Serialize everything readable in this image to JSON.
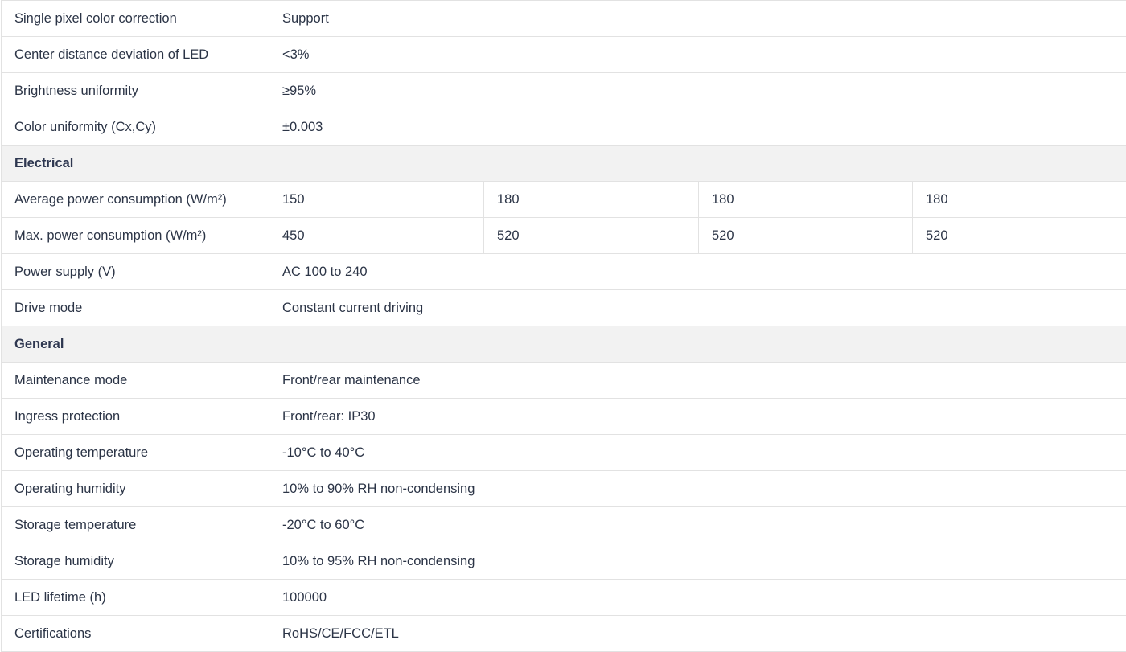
{
  "rows": [
    {
      "type": "spec",
      "label": "Single pixel color correction",
      "values": [
        "Support"
      ]
    },
    {
      "type": "spec",
      "label": "Center distance deviation of LED",
      "values": [
        "<3%"
      ]
    },
    {
      "type": "spec",
      "label": "Brightness uniformity",
      "values": [
        "≥95%"
      ]
    },
    {
      "type": "spec",
      "label": "Color uniformity (Cx,Cy)",
      "values": [
        "±0.003"
      ]
    },
    {
      "type": "section",
      "label": "Electrical"
    },
    {
      "type": "spec",
      "label": "Average power consumption (W/m²)",
      "values": [
        "150",
        "180",
        "180",
        "180"
      ]
    },
    {
      "type": "spec",
      "label": "Max. power consumption (W/m²)",
      "values": [
        "450",
        "520",
        "520",
        "520"
      ]
    },
    {
      "type": "spec",
      "label": "Power supply (V)",
      "values": [
        "AC 100 to 240"
      ]
    },
    {
      "type": "spec",
      "label": "Drive mode",
      "values": [
        "Constant current driving"
      ]
    },
    {
      "type": "section",
      "label": "General"
    },
    {
      "type": "spec",
      "label": "Maintenance mode",
      "values": [
        "Front/rear maintenance"
      ]
    },
    {
      "type": "spec",
      "label": "Ingress protection",
      "values": [
        "Front/rear: IP30"
      ]
    },
    {
      "type": "spec",
      "label": "Operating temperature",
      "values": [
        "-10°C to 40°C"
      ]
    },
    {
      "type": "spec",
      "label": "Operating humidity",
      "values": [
        "10% to 90% RH non-condensing"
      ]
    },
    {
      "type": "spec",
      "label": "Storage temperature",
      "values": [
        "-20°C to 60°C"
      ]
    },
    {
      "type": "spec",
      "label": "Storage humidity",
      "values": [
        "10% to 95% RH non-condensing"
      ]
    },
    {
      "type": "spec",
      "label": "LED lifetime (h)",
      "values": [
        "100000"
      ]
    },
    {
      "type": "spec",
      "label": "Certifications",
      "values": [
        "RoHS/CE/FCC/ETL"
      ]
    }
  ]
}
